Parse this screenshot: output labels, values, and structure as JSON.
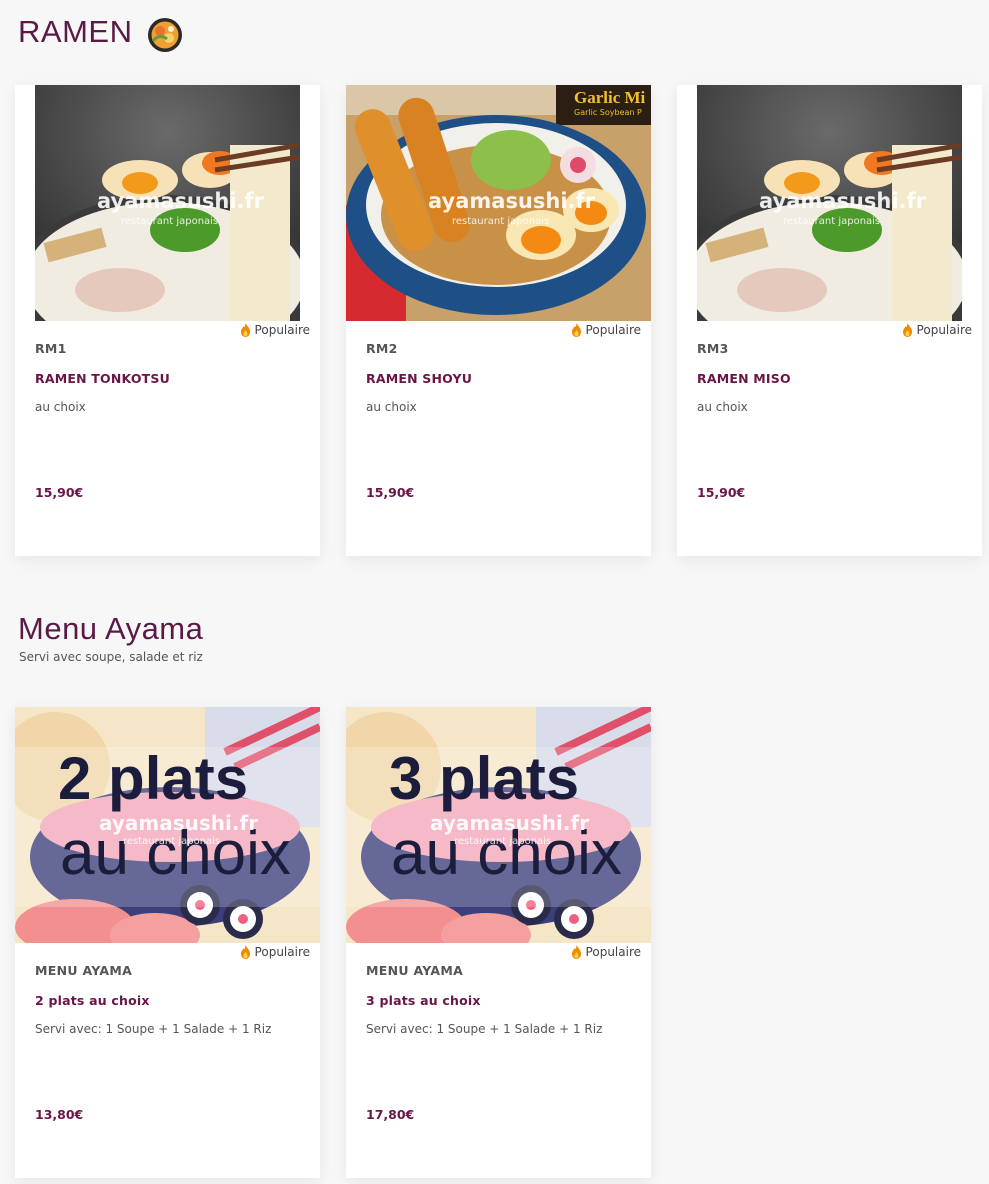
{
  "sections": [
    {
      "title": "RAMEN",
      "icon": "ramen-bowl-icon",
      "items": [
        {
          "code": "RM1",
          "name": "RAMEN TONKOTSU",
          "description": "au choix",
          "price": "15,90€",
          "badge": "Populaire",
          "image_watermark": "ayamasushi.fr",
          "image_watermark_sub": "restaurant japonais"
        },
        {
          "code": "RM2",
          "name": "RAMEN SHOYU",
          "description": "au choix",
          "price": "15,90€",
          "badge": "Populaire",
          "image_watermark": "ayamasushi.fr",
          "image_watermark_sub": "restaurant japonais",
          "image_sign": "Garlic Mi",
          "image_sign_sub": "Garlic Soybean P"
        },
        {
          "code": "RM3",
          "name": "RAMEN MISO",
          "description": "au choix",
          "price": "15,90€",
          "badge": "Populaire",
          "image_watermark": "ayamasushi.fr",
          "image_watermark_sub": "restaurant japonais"
        }
      ]
    },
    {
      "title": "Menu Ayama",
      "subtitle": "Servi avec soupe, salade et riz",
      "items": [
        {
          "code": "MENU AYAMA",
          "name": "2 plats au choix",
          "description": "Servi avec: 1 Soupe + 1 Salade + 1 Riz",
          "price": "13,80€",
          "badge": "Populaire",
          "image_line1": "2 plats",
          "image_line2": "au choix",
          "image_watermark": "ayamasushi.fr",
          "image_watermark_sub": "restaurant japonais"
        },
        {
          "code": "MENU AYAMA",
          "name": "3 plats au choix",
          "description": "Servi avec: 1 Soupe + 1 Salade + 1 Riz",
          "price": "17,80€",
          "badge": "Populaire",
          "image_line1": "3 plats",
          "image_line2": "au choix",
          "image_watermark": "ayamasushi.fr",
          "image_watermark_sub": "restaurant japonais"
        }
      ]
    }
  ],
  "colors": {
    "accent": "#5b1a45",
    "price": "#6b1447",
    "background": "#f7f7f7",
    "badge_fire": "#f08a00"
  }
}
